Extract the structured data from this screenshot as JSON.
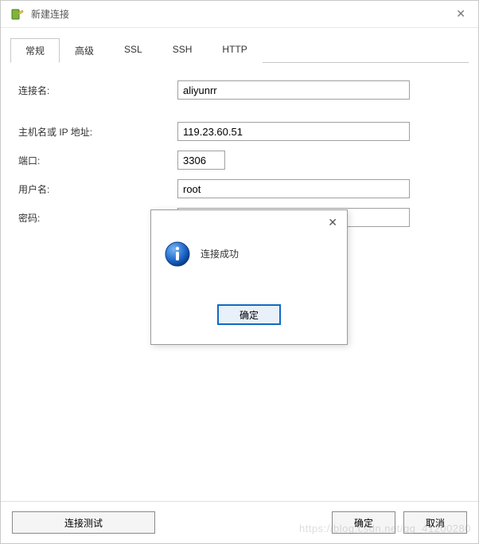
{
  "window": {
    "title": "新建连接"
  },
  "tabs": [
    {
      "label": "常规",
      "active": true
    },
    {
      "label": "高级",
      "active": false
    },
    {
      "label": "SSL",
      "active": false
    },
    {
      "label": "SSH",
      "active": false
    },
    {
      "label": "HTTP",
      "active": false
    }
  ],
  "form": {
    "connection_name_label": "连接名:",
    "connection_name_value": "aliyunrr",
    "host_label": "主机名或 IP 地址:",
    "host_value": "119.23.60.51",
    "port_label": "端口:",
    "port_value": "3306",
    "user_label": "用户名:",
    "user_value": "root",
    "password_label": "密码:",
    "password_value": "••••••••"
  },
  "buttons": {
    "test": "连接测试",
    "ok": "确定",
    "cancel": "取消"
  },
  "msgbox": {
    "text": "连接成功",
    "ok": "确定"
  },
  "watermark": "https://blog.csdn.net/qq_41200280"
}
